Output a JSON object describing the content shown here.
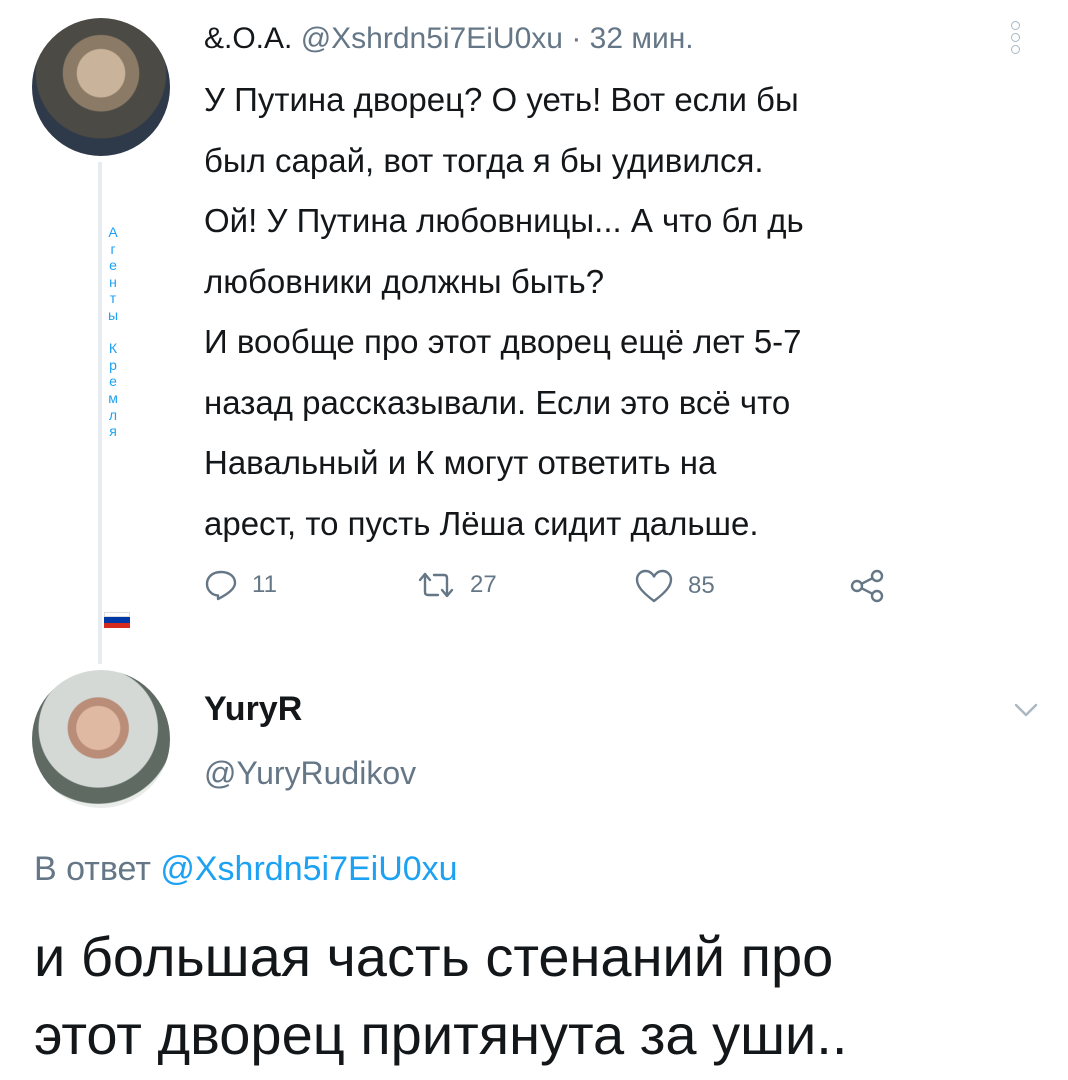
{
  "tweet1": {
    "name": "&.О.А.",
    "handle": "@Xshrdn5i7EiU0xu",
    "time": "· 32 мин.",
    "text": "У Путина дворец? О  уеть! Вот если бы\nбыл сарай, вот тогда я бы удивился.\nОй! У Путина любовницы... А что бл  дь\nлюбовники должны быть?\nИ вообще про этот дворец ещё лет 5-7\nназад рассказывали. Если это всё что\nНавальный и К могут ответить на\nарест, то пусть Лёша сидит дальше.",
    "vertical_label": "А\nг\nе\nн\nт\nы\n \nК\nр\nе\nм\nл\nя",
    "flag_colors": [
      "#ffffff",
      "#0039a6",
      "#d52b1e"
    ],
    "icons": {
      "reply": "reply-icon",
      "retweet": "retweet-icon",
      "like": "heart-icon",
      "share": "share-icon",
      "more": "more-icon"
    },
    "counts": {
      "replies": "11",
      "retweets": "27",
      "likes": "85"
    }
  },
  "reply": {
    "name": "YuryR",
    "handle": "@YuryRudikov",
    "reply_prefix": "В ответ",
    "reply_to": "@Xshrdn5i7EiU0xu",
    "text": "и большая часть стенаний про\nэтот дворец притянута за уши.."
  },
  "colors": {
    "accent": "#1da1f2",
    "muted": "#657786",
    "text": "#14171a"
  }
}
